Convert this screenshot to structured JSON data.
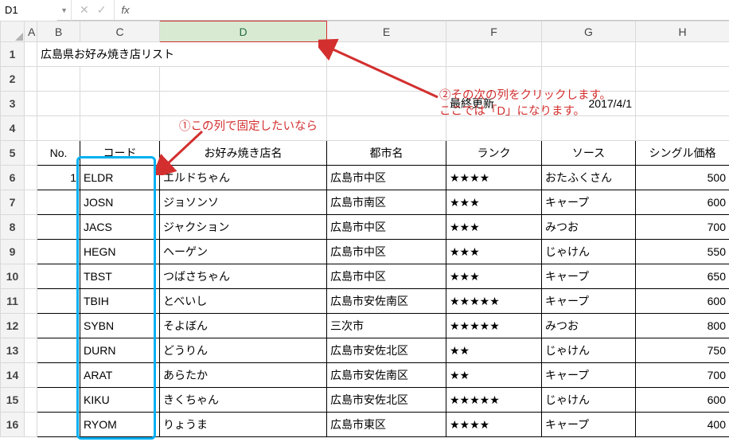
{
  "name_box": "D1",
  "fx_label": "fx",
  "col_headers": {
    "A": "A",
    "B": "B",
    "C": "C",
    "D": "D",
    "E": "E",
    "F": "F",
    "G": "G",
    "H": "H"
  },
  "row_headers": [
    "1",
    "2",
    "3",
    "4",
    "5",
    "6",
    "7",
    "8",
    "9",
    "10",
    "11",
    "12",
    "13",
    "14",
    "15",
    "16"
  ],
  "title": "広島県お好み焼き店リスト",
  "last_update_label": "最終更新",
  "last_update_value": "2017/4/1",
  "headers": {
    "no": "No.",
    "code": "コード",
    "shop": "お好み焼き店名",
    "city": "都市名",
    "rank": "ランク",
    "sauce": "ソース",
    "price": "シングル価格"
  },
  "rows": [
    {
      "no": "1",
      "code": "ELDR",
      "shop": "エルドちゃん",
      "city": "広島市中区",
      "rank": "★★★★",
      "sauce": "おたふくさん",
      "price": "500"
    },
    {
      "no": "",
      "code": "JOSN",
      "shop": "ジョソンソ",
      "city": "広島市南区",
      "rank": "★★★",
      "sauce": "キャープ",
      "price": "600"
    },
    {
      "no": "",
      "code": "JACS",
      "shop": "ジャクション",
      "city": "広島市中区",
      "rank": "★★★",
      "sauce": "みつお",
      "price": "700"
    },
    {
      "no": "",
      "code": "HEGN",
      "shop": "ヘーゲン",
      "city": "広島市中区",
      "rank": "★★★",
      "sauce": "じゃけん",
      "price": "550"
    },
    {
      "no": "",
      "code": "TBST",
      "shop": "つばさちゃん",
      "city": "広島市中区",
      "rank": "★★★",
      "sauce": "キャープ",
      "price": "650"
    },
    {
      "no": "",
      "code": "TBIH",
      "shop": "とべいし",
      "city": "広島市安佐南区",
      "rank": "★★★★★",
      "sauce": "キャープ",
      "price": "600"
    },
    {
      "no": "",
      "code": "SYBN",
      "shop": "そよぼん",
      "city": "三次市",
      "rank": "★★★★★",
      "sauce": "みつお",
      "price": "800"
    },
    {
      "no": "",
      "code": "DURN",
      "shop": "どうりん",
      "city": "広島市安佐北区",
      "rank": "★★",
      "sauce": "じゃけん",
      "price": "750"
    },
    {
      "no": "",
      "code": "ARAT",
      "shop": "あらたか",
      "city": "広島市安佐南区",
      "rank": "★★",
      "sauce": "キャープ",
      "price": "700"
    },
    {
      "no": "",
      "code": "KIKU",
      "shop": "きくちゃん",
      "city": "広島市安佐北区",
      "rank": "★★★★★",
      "sauce": "じゃけん",
      "price": "600"
    },
    {
      "no": "",
      "code": "RYOM",
      "shop": "りょうま",
      "city": "広島市東区",
      "rank": "★★★★",
      "sauce": "キャープ",
      "price": "400"
    }
  ],
  "annot1": "①この列で固定したいなら",
  "annot2_line1": "②その次の列をクリックします。",
  "annot2_line2": "ここでは「D」になります。"
}
